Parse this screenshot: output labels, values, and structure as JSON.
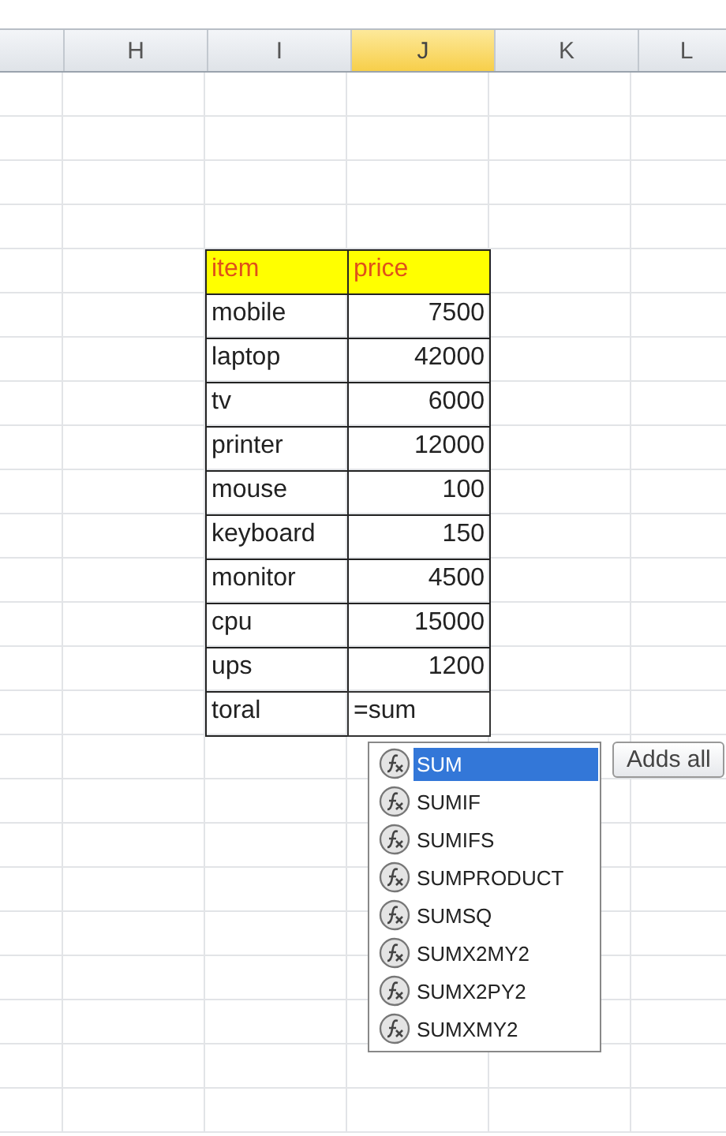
{
  "columns": [
    {
      "label": "H",
      "selected": false
    },
    {
      "label": "I",
      "selected": false
    },
    {
      "label": "J",
      "selected": true
    },
    {
      "label": "K",
      "selected": false
    },
    {
      "label": "L",
      "selected": false
    }
  ],
  "table": {
    "header": [
      "item",
      "price"
    ],
    "rows": [
      {
        "item": "mobile",
        "price": "7500"
      },
      {
        "item": "laptop",
        "price": "42000"
      },
      {
        "item": "tv",
        "price": "6000"
      },
      {
        "item": "printer",
        "price": "12000"
      },
      {
        "item": "mouse",
        "price": "100"
      },
      {
        "item": "keyboard",
        "price": "150"
      },
      {
        "item": "monitor",
        "price": "4500"
      },
      {
        "item": "cpu",
        "price": "15000"
      },
      {
        "item": "ups",
        "price": "1200"
      }
    ],
    "total": {
      "label": "toral",
      "input": "=sum"
    }
  },
  "autocomplete": {
    "items": [
      {
        "label": "SUM",
        "selected": true
      },
      {
        "label": "SUMIF",
        "selected": false
      },
      {
        "label": "SUMIFS",
        "selected": false
      },
      {
        "label": "SUMPRODUCT",
        "selected": false
      },
      {
        "label": "SUMSQ",
        "selected": false
      },
      {
        "label": "SUMX2MY2",
        "selected": false
      },
      {
        "label": "SUMX2PY2",
        "selected": false
      },
      {
        "label": "SUMXMY2",
        "selected": false
      }
    ],
    "tooltip": "Adds all"
  }
}
